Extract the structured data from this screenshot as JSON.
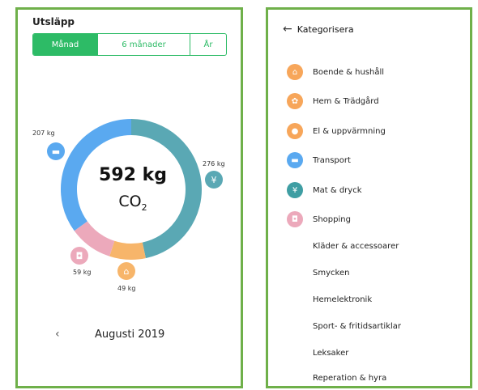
{
  "left": {
    "title": "Utsläpp",
    "tabs": [
      {
        "label": "Månad",
        "active": true
      },
      {
        "label": "6 månader",
        "active": false
      },
      {
        "label": "År",
        "active": false
      }
    ],
    "total": "592 kg",
    "unit_main": "CO",
    "unit_sub": "2",
    "segments": [
      {
        "name": "Mat & dryck",
        "value_kg": 276,
        "label": "276 kg",
        "color": "#5aa8b4",
        "icon": "fork-knife-icon",
        "glyph": "¥"
      },
      {
        "name": "Boende & hushåll",
        "value_kg": 49,
        "label": "49 kg",
        "color": "#f7b56a",
        "icon": "house-icon",
        "glyph": "⌂"
      },
      {
        "name": "Shopping",
        "value_kg": 59,
        "label": "59 kg",
        "color": "#eca9bb",
        "icon": "shopping-bag-icon",
        "glyph": "◘"
      },
      {
        "name": "Transport",
        "value_kg": 207,
        "label": "207 kg",
        "color": "#5aa9f0",
        "icon": "car-icon",
        "glyph": "▬"
      }
    ],
    "month": "Augusti 2019"
  },
  "right": {
    "title": "Kategorisera",
    "categories": [
      {
        "label": "Boende & hushåll",
        "color": "#f7a65a",
        "icon": "house-icon",
        "glyph": "⌂"
      },
      {
        "label": "Hem & Trädgård",
        "color": "#f7a65a",
        "icon": "flower-icon",
        "glyph": "✿"
      },
      {
        "label": "El & uppvärmning",
        "color": "#f7a65a",
        "icon": "lightbulb-icon",
        "glyph": "●"
      },
      {
        "label": "Transport",
        "color": "#5aa9f0",
        "icon": "car-icon",
        "glyph": "▬"
      },
      {
        "label": "Mat & dryck",
        "color": "#3f9ea3",
        "icon": "fork-knife-icon",
        "glyph": "¥"
      },
      {
        "label": "Shopping",
        "color": "#eca9bb",
        "icon": "shopping-bag-icon",
        "glyph": "◘"
      }
    ],
    "subcategories": [
      "Kläder & accessoarer",
      "Smycken",
      "Hemelektronik",
      "Sport- & fritidsartiklar",
      "Leksaker",
      "Reperation & hyra"
    ]
  }
}
